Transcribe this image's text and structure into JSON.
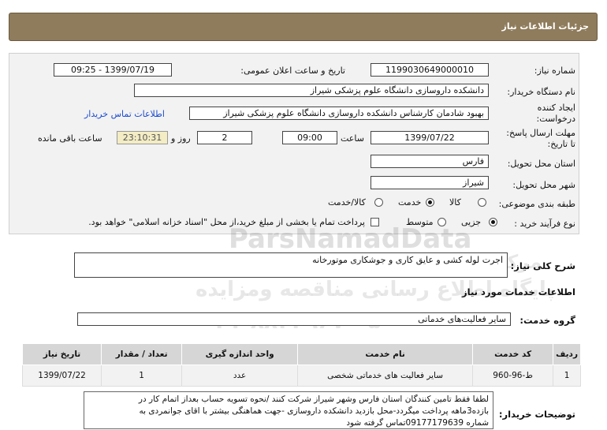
{
  "header": {
    "title": "جزئیات اطلاعات نیاز"
  },
  "form": {
    "need_number_label": "شماره نیاز:",
    "need_number": "1199030649000010",
    "announce_label": "تاریخ و ساعت اعلان عمومی:",
    "announce_value": "1399/07/19 - 09:25",
    "buyer_label": "نام دستگاه خریدار:",
    "buyer_value": "دانشکده داروسازی دانشگاه علوم پزشکی شیراز",
    "creator_label_1": "ایجاد کننده",
    "creator_label_2": "درخواست:",
    "creator_value": "بهبود  شادمان  کارشناس  دانشکده داروسازی دانشگاه علوم پزشکی شیراز",
    "contact_link": "اطلاعات تماس خریدار",
    "deadline_label_1": "مهلت ارسال پاسخ:",
    "deadline_label_2": "تا تاریخ:",
    "deadline_date": "1399/07/22",
    "time_label": "ساعت",
    "deadline_time": "09:00",
    "days_value": "2",
    "days_label": "روز و",
    "remaining_value": "23:10:31",
    "remaining_label": "ساعت باقی مانده",
    "province_label": "استان محل تحویل:",
    "province_value": "فارس",
    "city_label": "شهر محل تحویل:",
    "city_value": "شیراز",
    "category_label": "طبقه بندی موضوعی:",
    "category_options": [
      "کالا",
      "خدمت",
      "کالا/خدمت"
    ],
    "process_label": "نوع فرآیند خرید :",
    "process_options": [
      "جزیی",
      "متوسط"
    ],
    "payment_note": "پرداخت تمام یا بخشی از مبلغ خرید،از محل \"اسناد خزانه اسلامی\" خواهد بود."
  },
  "summary": {
    "label": "شرح کلی نیاز:",
    "value": "اجرت لوله کشی و عایق کاری و جوشکاری موتورخانه"
  },
  "services_title": "اطلاعات خدمات مورد نیاز",
  "service_group": {
    "label": "گروه خدمت:",
    "value": "سایر فعالیت‌های خدماتی"
  },
  "table": {
    "headers": [
      "ردیف",
      "کد خدمت",
      "نام خدمت",
      "واحد اندازه گیری",
      "تعداد / مقدار",
      "تاریخ نیاز"
    ],
    "rows": [
      [
        "1",
        "ط-96-960",
        "سایر فعالیت های خدماتی شخصی",
        "عدد",
        "1",
        "1399/07/22"
      ]
    ]
  },
  "buyer_notes": {
    "label": "توضیحات خریدار:",
    "lines": [
      "لطفا فقط تامین کنندگان استان فارس وشهر شیراز شرکت کنند /نحوه تسویه حساب بعداز اتمام کار در",
      "بازده3ماهه پرداخت میگردد-محل بازدید دانشکده داروسازی -جهت هماهنگی بیشتر با اقای جوانمردی به",
      "شماره 09177179639تماس گرفته شود"
    ]
  },
  "watermark": {
    "brand": "ParsNamadData",
    "line1": "مرکز فراوری اطلاعات پارس نماد داده",
    "line2": "پایگاه اطلاع رسانی مناقصه ومزایده",
    "line3": "۰۲۱-۸۸۳۴۹۶۷۰-۵"
  }
}
